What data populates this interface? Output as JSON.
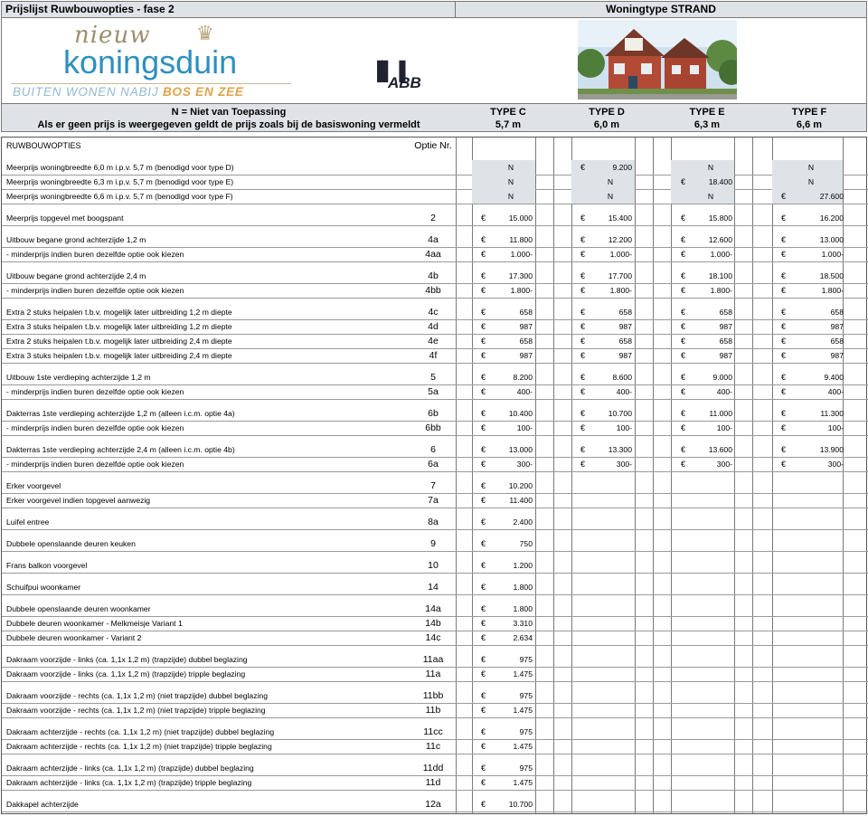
{
  "header": {
    "title_left": "Prijslijst Ruwbouwopties - fase 2",
    "title_right": "Woningtype STRAND",
    "logo_nieuw": "nieuw",
    "logo_name": "koningsduin",
    "logo_tagline_prefix": "BUITEN WONEN NABIJ ",
    "logo_tagline_bold": "BOS EN ZEE",
    "abb_logo": "ABB"
  },
  "legend": {
    "line1": "N = Niet van Toepassing",
    "line2": "Als er geen prijs is weergegeven geldt de prijs zoals bij de basiswoning vermeldt",
    "types": [
      {
        "name": "TYPE C",
        "width": "5,7 m"
      },
      {
        "name": "TYPE D",
        "width": "6,0 m"
      },
      {
        "name": "TYPE E",
        "width": "6,3 m"
      },
      {
        "name": "TYPE F",
        "width": "6,6 m"
      }
    ]
  },
  "section_title": "RUWBOUWOPTIES",
  "option_header": "Optie Nr.",
  "currency_symbol": "€",
  "rows": [
    {
      "label": "Meerprijs woningbreedte 6,0 m i.p.v. 5,7 m (benodigd voor type D)",
      "opt": "",
      "c": "N",
      "d": "9.200",
      "e": "N",
      "f": "N"
    },
    {
      "label": "Meerprijs woningbreedte 6,3 m i.p.v. 5,7 m (benodigd voor type E)",
      "opt": "",
      "c": "N",
      "d": "N",
      "e": "18.400",
      "f": "N"
    },
    {
      "label": "Meerprijs woningbreedte 6,6 m i.p.v. 5,7 m (benodigd voor type F)",
      "opt": "",
      "c": "N",
      "d": "N",
      "e": "N",
      "f": "27.600"
    },
    {
      "label": "Meerprijs topgevel met boogspant",
      "opt": "2",
      "c": "15.000",
      "d": "15.400",
      "e": "15.800",
      "f": "16.200"
    },
    {
      "label": "Uitbouw begane grond achterzijde 1,2 m",
      "opt": "4a",
      "c": "11.800",
      "d": "12.200",
      "e": "12.600",
      "f": "13.000"
    },
    {
      "label": " - minderprijs indien buren dezelfde optie ook kiezen",
      "opt": "4aa",
      "c": "1.000-",
      "d": "1.000-",
      "e": "1.000-",
      "f": "1.000-"
    },
    {
      "label": "Uitbouw begane grond achterzijde 2,4 m",
      "opt": "4b",
      "c": "17.300",
      "d": "17.700",
      "e": "18.100",
      "f": "18.500"
    },
    {
      "label": " - minderprijs indien buren dezelfde optie ook kiezen",
      "opt": "4bb",
      "c": "1.800-",
      "d": "1.800-",
      "e": "1.800-",
      "f": "1.800-"
    },
    {
      "label": "Extra 2 stuks heipalen t.b.v. mogelijk later uitbreiding 1,2 m diepte",
      "opt": "4c",
      "c": "658",
      "d": "658",
      "e": "658",
      "f": "658"
    },
    {
      "label": "Extra 3 stuks heipalen t.b.v. mogelijk later uitbreiding 1,2 m diepte",
      "opt": "4d",
      "c": "987",
      "d": "987",
      "e": "987",
      "f": "987"
    },
    {
      "label": "Extra 2 stuks heipalen t.b.v. mogelijk later uitbreiding 2,4 m diepte",
      "opt": "4e",
      "c": "658",
      "d": "658",
      "e": "658",
      "f": "658"
    },
    {
      "label": "Extra 3 stuks heipalen t.b.v. mogelijk later uitbreiding 2,4 m diepte",
      "opt": "4f",
      "c": "987",
      "d": "987",
      "e": "987",
      "f": "987"
    },
    {
      "label": "Uitbouw 1ste verdieping achterzijde 1,2 m",
      "opt": "5",
      "c": "8.200",
      "d": "8.600",
      "e": "9.000",
      "f": "9.400"
    },
    {
      "label": " - minderprijs indien buren dezelfde optie ook kiezen",
      "opt": "5a",
      "c": "400-",
      "d": "400-",
      "e": "400-",
      "f": "400-"
    },
    {
      "label": "Dakterras 1ste verdieping achterzijde 1,2 m (alleen i.c.m. optie 4a)",
      "opt": "6b",
      "c": "10.400",
      "d": "10.700",
      "e": "11.000",
      "f": "11.300"
    },
    {
      "label": " - minderprijs indien buren dezelfde optie ook kiezen",
      "opt": "6bb",
      "c": "100-",
      "d": "100-",
      "e": "100-",
      "f": "100-"
    },
    {
      "label": "Dakterras 1ste verdieping achterzijde 2,4 m (alleen i.c.m. optie 4b)",
      "opt": "6",
      "c": "13.000",
      "d": "13.300",
      "e": "13.600",
      "f": "13.900"
    },
    {
      "label": " - minderprijs indien buren dezelfde optie ook kiezen",
      "opt": "6a",
      "c": "300-",
      "d": "300-",
      "e": "300-",
      "f": "300-"
    },
    {
      "label": "Erker voorgevel",
      "opt": "7",
      "c": "10.200",
      "d": "",
      "e": "",
      "f": ""
    },
    {
      "label": "Erker voorgevel indien topgevel aanwezig",
      "opt": "7a",
      "c": "11.400",
      "d": "",
      "e": "",
      "f": ""
    },
    {
      "label": "Luifel entree",
      "opt": "8a",
      "c": "2.400",
      "d": "",
      "e": "",
      "f": ""
    },
    {
      "label": "Dubbele openslaande deuren keuken",
      "opt": "9",
      "c": "750",
      "d": "",
      "e": "",
      "f": ""
    },
    {
      "label": "Frans balkon voorgevel",
      "opt": "10",
      "c": "1.200",
      "d": "",
      "e": "",
      "f": ""
    },
    {
      "label": "Schuifpui woonkamer",
      "opt": "14",
      "c": "1.800",
      "d": "",
      "e": "",
      "f": ""
    },
    {
      "label": "Dubbele openslaande deuren woonkamer",
      "opt": "14a",
      "c": "1.800",
      "d": "",
      "e": "",
      "f": ""
    },
    {
      "label": "Dubbele deuren woonkamer - Melkmeisje Variant 1",
      "opt": "14b",
      "c": "3.310",
      "d": "",
      "e": "",
      "f": ""
    },
    {
      "label": "Dubbele deuren woonkamer - Variant 2",
      "opt": "14c",
      "c": "2.634",
      "d": "",
      "e": "",
      "f": ""
    },
    {
      "label": "Dakraam voorzijde - links (ca. 1,1x 1,2 m) (trapzijde) dubbel beglazing",
      "opt": "11aa",
      "c": "975",
      "d": "",
      "e": "",
      "f": ""
    },
    {
      "label": "Dakraam voorzijde - links (ca. 1,1x 1,2 m) (trapzijde) tripple beglazing",
      "opt": "11a",
      "c": "1.475",
      "d": "",
      "e": "",
      "f": ""
    },
    {
      "label": "Dakraam voorzijde - rechts (ca. 1,1x 1,2 m) (niet trapzijde) dubbel beglazing",
      "opt": "11bb",
      "c": "975",
      "d": "",
      "e": "",
      "f": ""
    },
    {
      "label": "Dakraam voorzijde - rechts (ca. 1,1x 1,2 m) (niet trapzijde) tripple beglazing",
      "opt": "11b",
      "c": "1.475",
      "d": "",
      "e": "",
      "f": ""
    },
    {
      "label": "Dakraam achterzijde - rechts (ca. 1,1x 1,2 m) (niet trapzijde) dubbel beglazing",
      "opt": "11cc",
      "c": "975",
      "d": "",
      "e": "",
      "f": ""
    },
    {
      "label": "Dakraam achterzijde - rechts (ca. 1,1x 1,2 m) (niet trapzijde) tripple beglazing",
      "opt": "11c",
      "c": "1.475",
      "d": "",
      "e": "",
      "f": ""
    },
    {
      "label": "Dakraam achterzijde - links (ca. 1,1x 1,2 m) (trapzijde) dubbel beglazing",
      "opt": "11dd",
      "c": "975",
      "d": "",
      "e": "",
      "f": ""
    },
    {
      "label": "Dakraam achterzijde - links (ca. 1,1x 1,2 m) (trapzijde) tripple beglazing",
      "opt": "11d",
      "c": "1.475",
      "d": "",
      "e": "",
      "f": ""
    },
    {
      "label": "Dakkapel achterzijde",
      "opt": "12a",
      "c": "10.700",
      "d": "",
      "e": "",
      "f": ""
    }
  ]
}
